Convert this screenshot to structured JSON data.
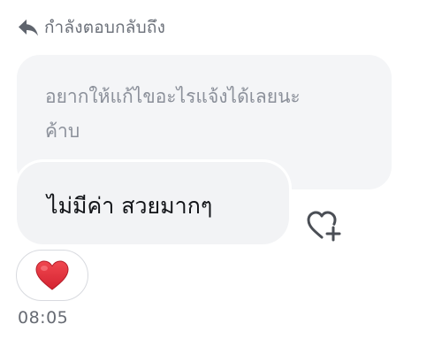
{
  "reply_header": {
    "icon": "reply-arrow-icon",
    "label": "กำลังตอบกลับถึง"
  },
  "quoted_message": {
    "text": "อยากให้แก้ไขอะไรแจ้งได้เลยนะ\nค้าบ"
  },
  "message": {
    "text": "ไม่มีค่า สวยมากๆ"
  },
  "react_button": {
    "icon": "heart-plus-icon"
  },
  "reaction": {
    "emoji": "❤️",
    "icon": "red-heart-icon"
  },
  "timestamp": "08:05",
  "colors": {
    "bubble_background": "#f2f3f5",
    "secondary_text": "#6b7079",
    "heart_red": "#e52f3a"
  }
}
